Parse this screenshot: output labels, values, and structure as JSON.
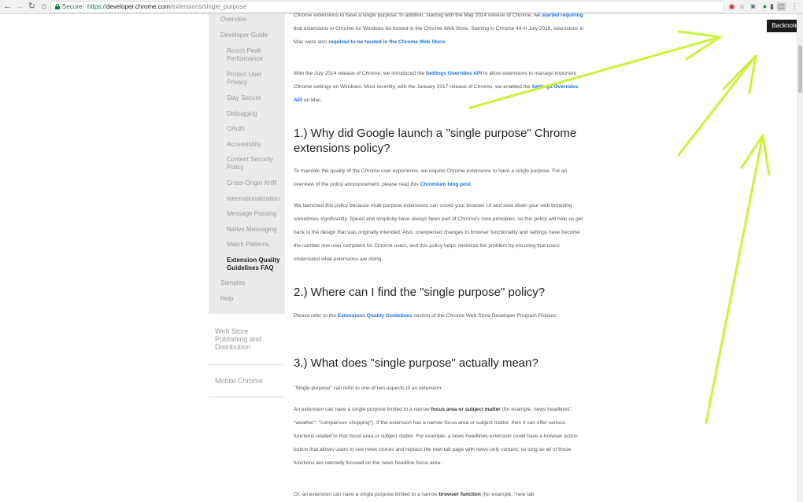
{
  "browser": {
    "secure_label": "Secure",
    "url_scheme": "https://",
    "url_host": "developer.chrome.com",
    "url_path": "/extensions/single_purpose",
    "tooltip": "Backnote"
  },
  "sidebar": {
    "overview": "Overview",
    "developer_guide": "Developer Guide",
    "items": [
      "Reach Peak Performance",
      "Protect User Privacy",
      "Stay Secure",
      "Debugging",
      "OAuth",
      "Accessibility",
      "Content Security Policy",
      "Cross-Origin XHR",
      "Internationalization",
      "Message Passing",
      "Native Messaging",
      "Match Patterns",
      "Extension Quality Guidelines FAQ"
    ],
    "samples": "Samples",
    "help": "Help",
    "web_store": "Web Store Publishing and Distribution",
    "mobile_chrome": "Mobile Chrome"
  },
  "article": {
    "intro1_a": "Chrome extensions to have a single purpose. In addition, starting with the May 2014 release of Chrome, we ",
    "intro1_link1": "started requiring",
    "intro1_b": " that extensions in Chrome for Windows be hosted in the Chrome Web Store. Starting in Chrome 44 in July 2015, extensions in Mac were also ",
    "intro1_link2": "required to be hosted in the Chrome Web Store",
    "intro1_c": ".",
    "intro2_a": "With the July 2014 release of Chrome, we introduced the ",
    "intro2_link1": "Settings Overrides API",
    "intro2_b": " to allow extensions to manage important Chrome settings on Windows. Most recently, with the January 2017 release of Chrome, we enabled the ",
    "intro2_link2": "Settings Overrides API",
    "intro2_c": " on Mac.",
    "q1_heading": "1.) Why did Google launch a \"single purpose\" Chrome extensions policy?",
    "q1_p1_a": "To maintain the quality of the Chrome user experience, we require Chrome extensions to have a single purpose. For an overview of the policy announcement, please read this ",
    "q1_p1_link": "Chromium blog post",
    "q1_p1_b": ".",
    "q1_p2": "We launched this policy because multi-purpose extensions can crowd your browser UI and slow down your web browsing sometimes significantly. Speed and simplicity have always been part of Chrome's core principles, so this policy will help us get back to the design that was originally intended. Also, unexpected changes to browser functionality and settings have become the number one user complaint for Chrome users, and this policy helps minimize the problem by ensuring that users understand what extensions are doing.",
    "q2_heading": "2.) Where can I find the \"single purpose\" policy?",
    "q2_p1_a": "Please refer to the ",
    "q2_p1_link": "Extensions Quality Guidelines",
    "q2_p1_b": " section of the Chrome Web Store Developer Program Policies.",
    "q3_heading": "3.) What does \"single purpose\" actually mean?",
    "q3_p1": "\"Single purpose\" can refer to one of two aspects of an extension:",
    "q3_p2_a": "An extension can have a single purpose limited to a narrow ",
    "q3_p2_bold": "focus area or subject matter",
    "q3_p2_b": " (for example, news headlines\", \"weather\", \"comparison shopping\"). If the extension has a narrow focus area or subject matter, then it can offer various functions related to that focus area or subject matter. For example, a news headlines extension could have a browser action button that allows users to see news stories and replace the new tab page with news-only content, so long as all of those functions are narrowly focused on the news headline focus area.",
    "q3_p3_a": "Or, an extension can have a single purpose limited to a narrow ",
    "q3_p3_bold": "browser function",
    "q3_p3_b": " (for example, \"new tab"
  },
  "colors": {
    "arrow": "#ccf23a",
    "link": "#1a73e8",
    "secure": "#0b8043"
  },
  "icons": [
    "back-icon",
    "forward-icon",
    "reload-icon",
    "home-icon",
    "lock-icon",
    "bookmark-star-icon",
    "extension-icons",
    "menu-icon"
  ]
}
